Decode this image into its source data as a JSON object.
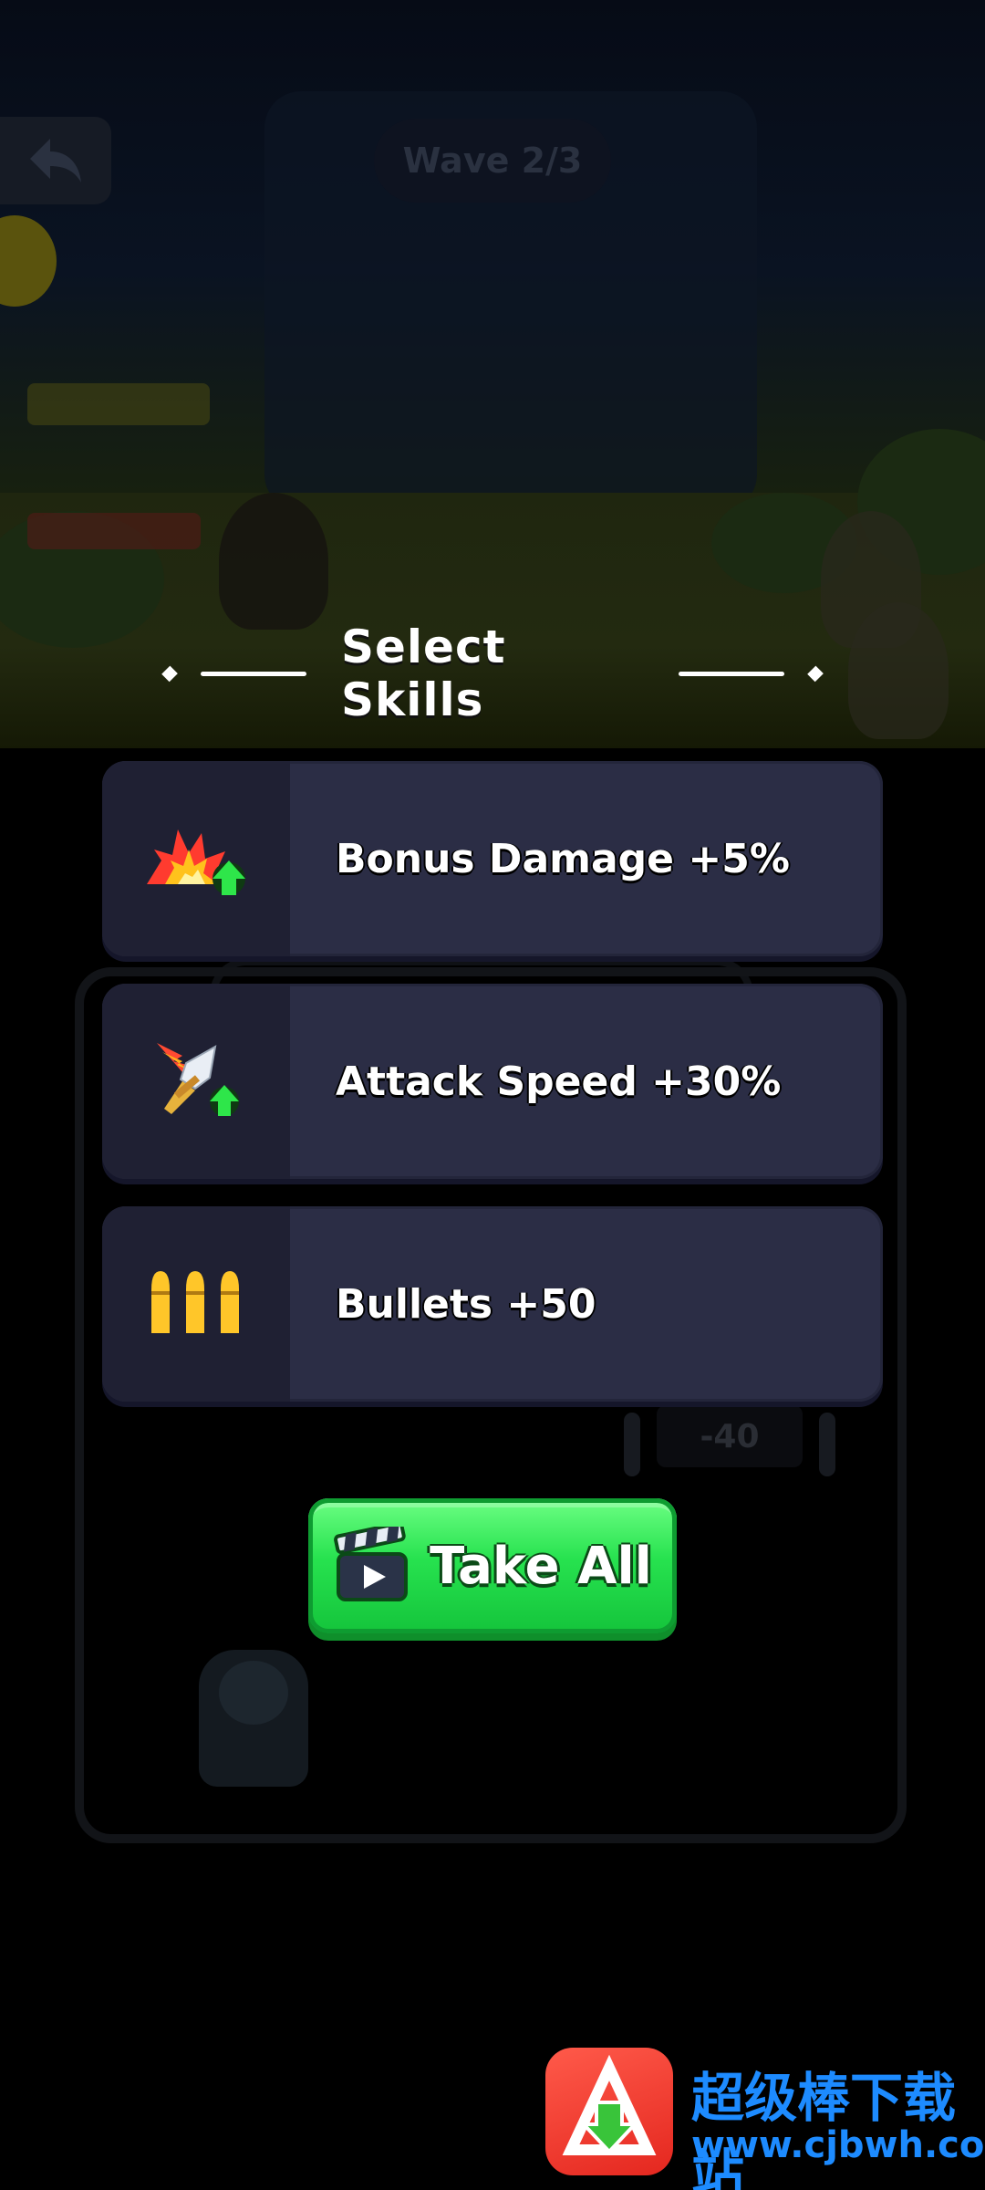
{
  "hud": {
    "wave_label": "Wave 2/3"
  },
  "arena": {
    "damage_popup": "-40"
  },
  "skills": {
    "title": "Select Skills",
    "options": [
      {
        "label": "Bonus Damage +5%",
        "icon": "explosion-up-icon"
      },
      {
        "label": "Attack Speed +30%",
        "icon": "flaming-sword-up-icon"
      },
      {
        "label": "Bullets +50",
        "icon": "bullets-icon"
      }
    ],
    "take_all_label": "Take All",
    "take_all_icon": "video-clapper-icon"
  },
  "watermark": {
    "site_name": "超级棒下载站",
    "url": "www.cjbwh.com"
  },
  "colors": {
    "card_bg": "#2b2d45",
    "icon_cell_bg": "#1f2033",
    "button_green": "#27e24f"
  }
}
